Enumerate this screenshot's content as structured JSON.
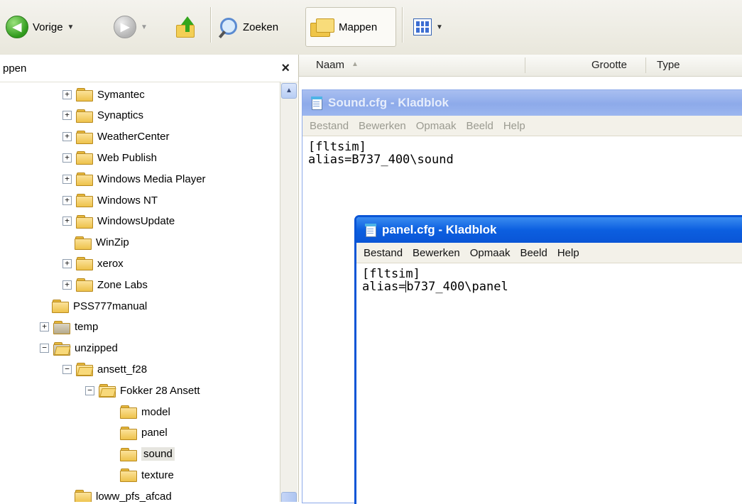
{
  "toolbar": {
    "back_label": "Vorige",
    "search_label": "Zoeken",
    "folders_label": "Mappen"
  },
  "left_pane": {
    "title": "ppen",
    "close_symbol": "×",
    "tree": [
      {
        "label": "Symantec",
        "expander": "+"
      },
      {
        "label": "Synaptics",
        "expander": "+"
      },
      {
        "label": "WeatherCenter",
        "expander": "+"
      },
      {
        "label": "Web Publish",
        "expander": "+"
      },
      {
        "label": "Windows Media Player",
        "expander": "+"
      },
      {
        "label": "Windows NT",
        "expander": "+"
      },
      {
        "label": "WindowsUpdate",
        "expander": "+"
      },
      {
        "label": "WinZip",
        "expander": ""
      },
      {
        "label": "xerox",
        "expander": "+"
      },
      {
        "label": "Zone Labs",
        "expander": "+"
      },
      {
        "label": "PSS777manual",
        "expander": ""
      },
      {
        "label": "temp",
        "expander": "+"
      },
      {
        "label": "unzipped",
        "expander": "−"
      },
      {
        "label": "ansett_f28",
        "expander": "−"
      },
      {
        "label": "Fokker 28 Ansett",
        "expander": "−"
      },
      {
        "label": "model",
        "expander": ""
      },
      {
        "label": "panel",
        "expander": ""
      },
      {
        "label": "sound",
        "expander": ""
      },
      {
        "label": "texture",
        "expander": ""
      },
      {
        "label": "loww_pfs_afcad",
        "expander": ""
      }
    ]
  },
  "details": {
    "col_name": "Naam",
    "col_size": "Grootte",
    "col_type": "Type"
  },
  "sound_window": {
    "title": "Sound.cfg - Kladblok",
    "menu": [
      "Bestand",
      "Bewerken",
      "Opmaak",
      "Beeld",
      "Help"
    ],
    "line1": "[fltsim]",
    "line2": "alias=B737_400\\sound"
  },
  "panel_window": {
    "title": "panel.cfg - Kladblok",
    "menu": [
      "Bestand",
      "Bewerken",
      "Opmaak",
      "Beeld",
      "Help"
    ],
    "line1": "[fltsim]",
    "line2_before_cursor": "alias=",
    "line2_after_cursor": "b737_400\\panel"
  }
}
